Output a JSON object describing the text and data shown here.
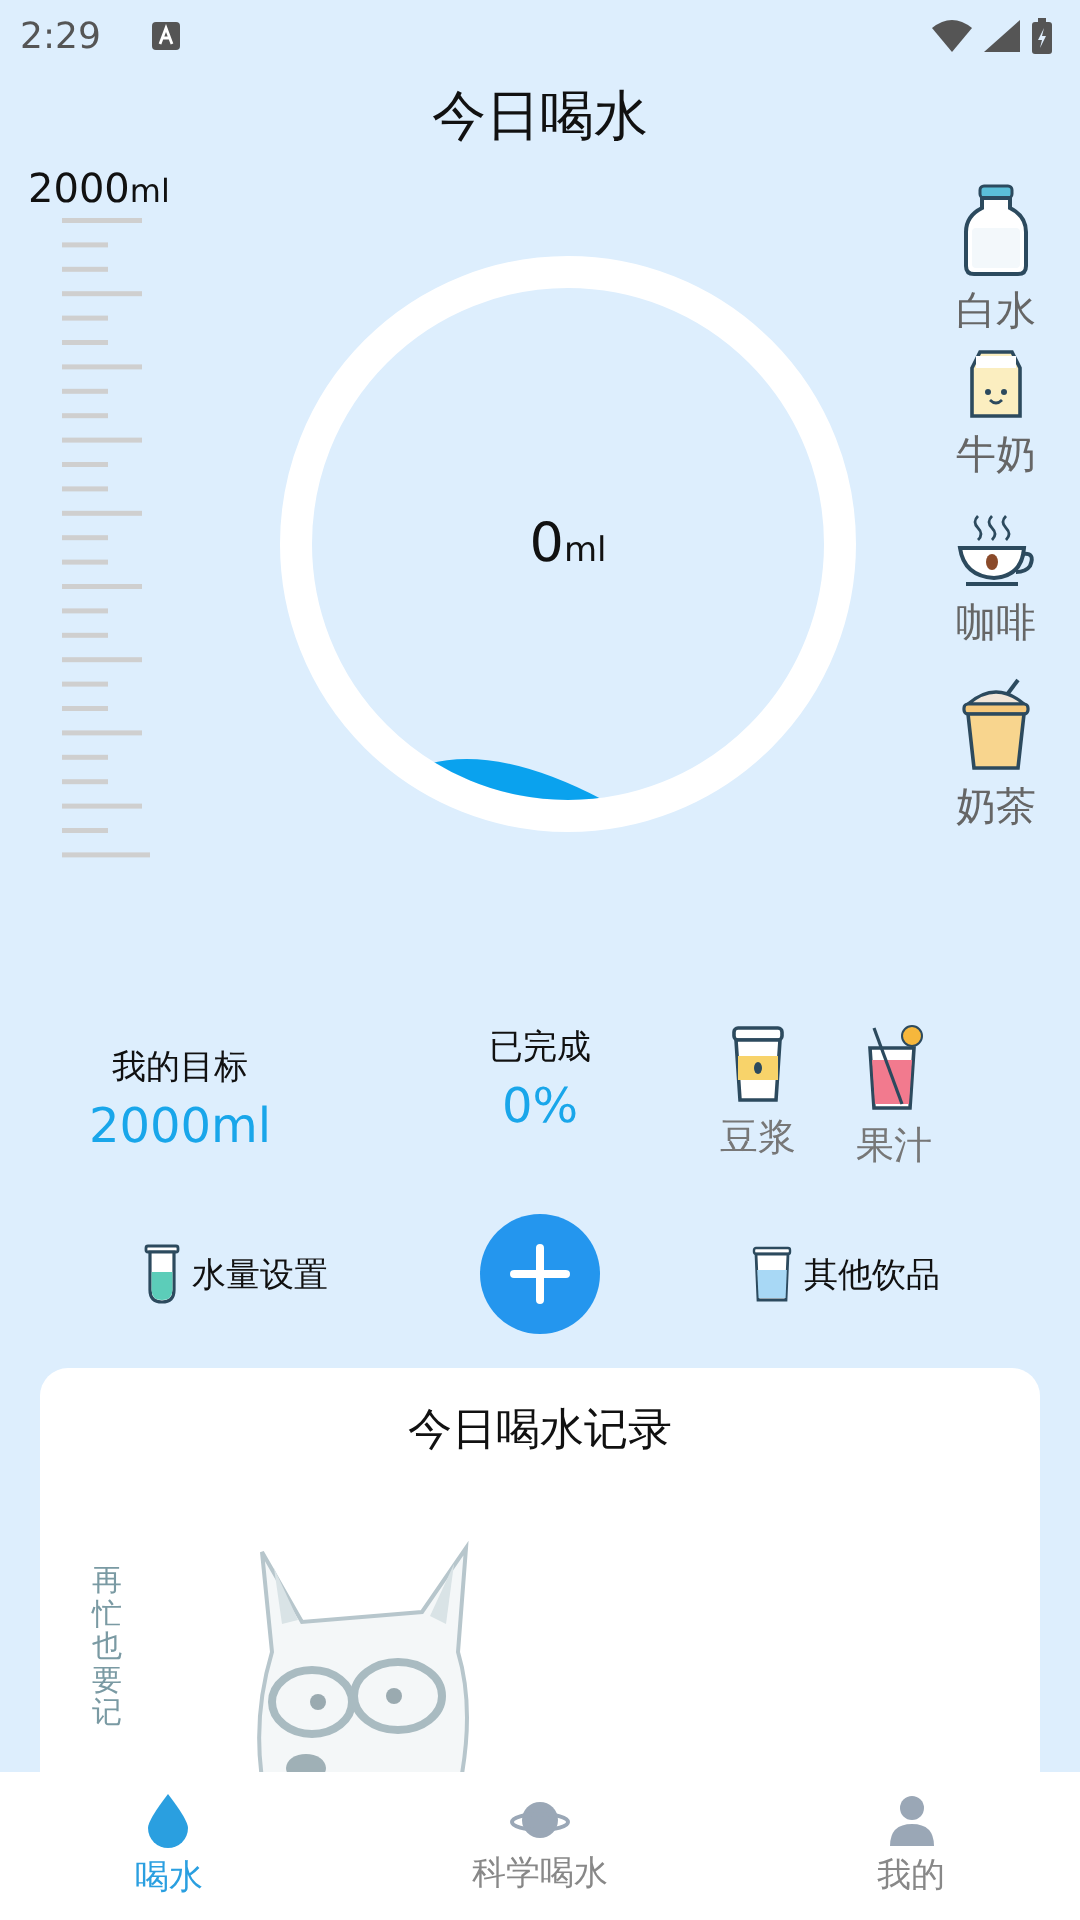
{
  "status_bar": {
    "time": "2:29"
  },
  "header": {
    "title": "今日喝水"
  },
  "scale": {
    "max_value": "2000",
    "max_unit": "ml"
  },
  "gauge": {
    "amount": "0",
    "unit": "ml"
  },
  "drinks": [
    {
      "label": "白水",
      "kind": "water"
    },
    {
      "label": "牛奶",
      "kind": "milk"
    },
    {
      "label": "咖啡",
      "kind": "coffee"
    },
    {
      "label": "奶茶",
      "kind": "milktea"
    }
  ],
  "stats": {
    "goal_label": "我的目标",
    "goal_value": "2000ml",
    "done_label": "已完成",
    "done_value": "0%"
  },
  "extra_drinks": [
    {
      "label": "豆浆",
      "kind": "soymilk"
    },
    {
      "label": "果汁",
      "kind": "juice"
    }
  ],
  "actions": {
    "left_label": "水量设置",
    "right_label": "其他饮品"
  },
  "record": {
    "title": "今日喝水记录",
    "caption": "再忙也要记"
  },
  "nav": [
    {
      "label": "喝水",
      "kind": "drop",
      "selected": true
    },
    {
      "label": "科学喝水",
      "kind": "planet",
      "selected": false
    },
    {
      "label": "我的",
      "kind": "person",
      "selected": false
    }
  ]
}
